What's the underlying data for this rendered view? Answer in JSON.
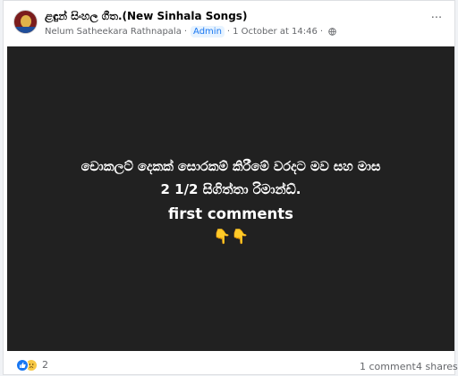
{
  "post": {
    "page_name": "ළඳුන් සිංහල ගීත.(New Sinhala Songs)",
    "author": "Nelum Satheekara Rathnapala",
    "role_badge": "Admin",
    "timestamp": "1 October at 14:46",
    "separator": "·",
    "more_label": "···"
  },
  "image_text": {
    "line1": "චොකලට් දෙකක් සොරකම් කිරීමේ වරදට මව සහ මාස",
    "line2": "2 1/2 සිගිත්තා රිමාන්ඩ්.",
    "line3": "first comments",
    "line4": "👇👇"
  },
  "footer": {
    "reaction_count": "2",
    "comments": "1 comment",
    "shares": "4 shares"
  },
  "colors": {
    "image_bg": "#212121",
    "accent": "#1877f2",
    "muted_text": "#65676b"
  }
}
